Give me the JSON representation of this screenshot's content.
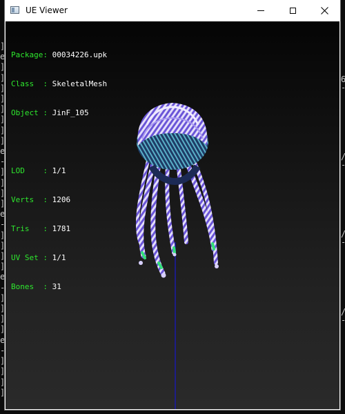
{
  "window": {
    "title": "UE Viewer",
    "minimize_label": "",
    "maximize_label": "",
    "close_label": ""
  },
  "info": {
    "package_label": "Package: ",
    "package_value": "00034226.upk",
    "class_label": "Class  : ",
    "class_value": "SkeletalMesh",
    "object_label": "Object : ",
    "object_value": "JinF_105",
    "lod_label": "LOD    : ",
    "lod_value": "1/1",
    "verts_label": "Verts  : ",
    "verts_value": "1206",
    "tris_label": "Tris   : ",
    "tris_value": "1781",
    "uvset_label": "UV Set : ",
    "uvset_value": "1/1",
    "bones_label": "Bones  : ",
    "bones_value": "31"
  },
  "console": {
    "left_lines": [
      "]",
      "e",
      "]",
      "]",
      "]",
      "]",
      "]",
      "]",
      "]",
      "]",
      "e",
      "-",
      "]",
      "]",
      "]",
      "]",
      "e",
      "-",
      "]",
      "]",
      "]",
      "]",
      "e",
      "-",
      "]",
      "]",
      "]",
      "]",
      "e",
      "-",
      "]",
      "]",
      "]",
      "]"
    ],
    "right_marks": [
      "6",
      "-",
      "/",
      "-",
      "/",
      "-",
      "/",
      "-"
    ]
  },
  "colors": {
    "label_green": "#2ee82e",
    "value_white": "#ffffff",
    "mesh_purple": "#6a55d8",
    "mesh_light": "#d8d0ff",
    "tip_green": "#33e07a",
    "bone_blue": "#1a1aa8"
  },
  "icons": {
    "app": "ue-viewer-window-icon",
    "minimize": "minimize-icon",
    "maximize": "maximize-icon",
    "close": "close-icon"
  }
}
